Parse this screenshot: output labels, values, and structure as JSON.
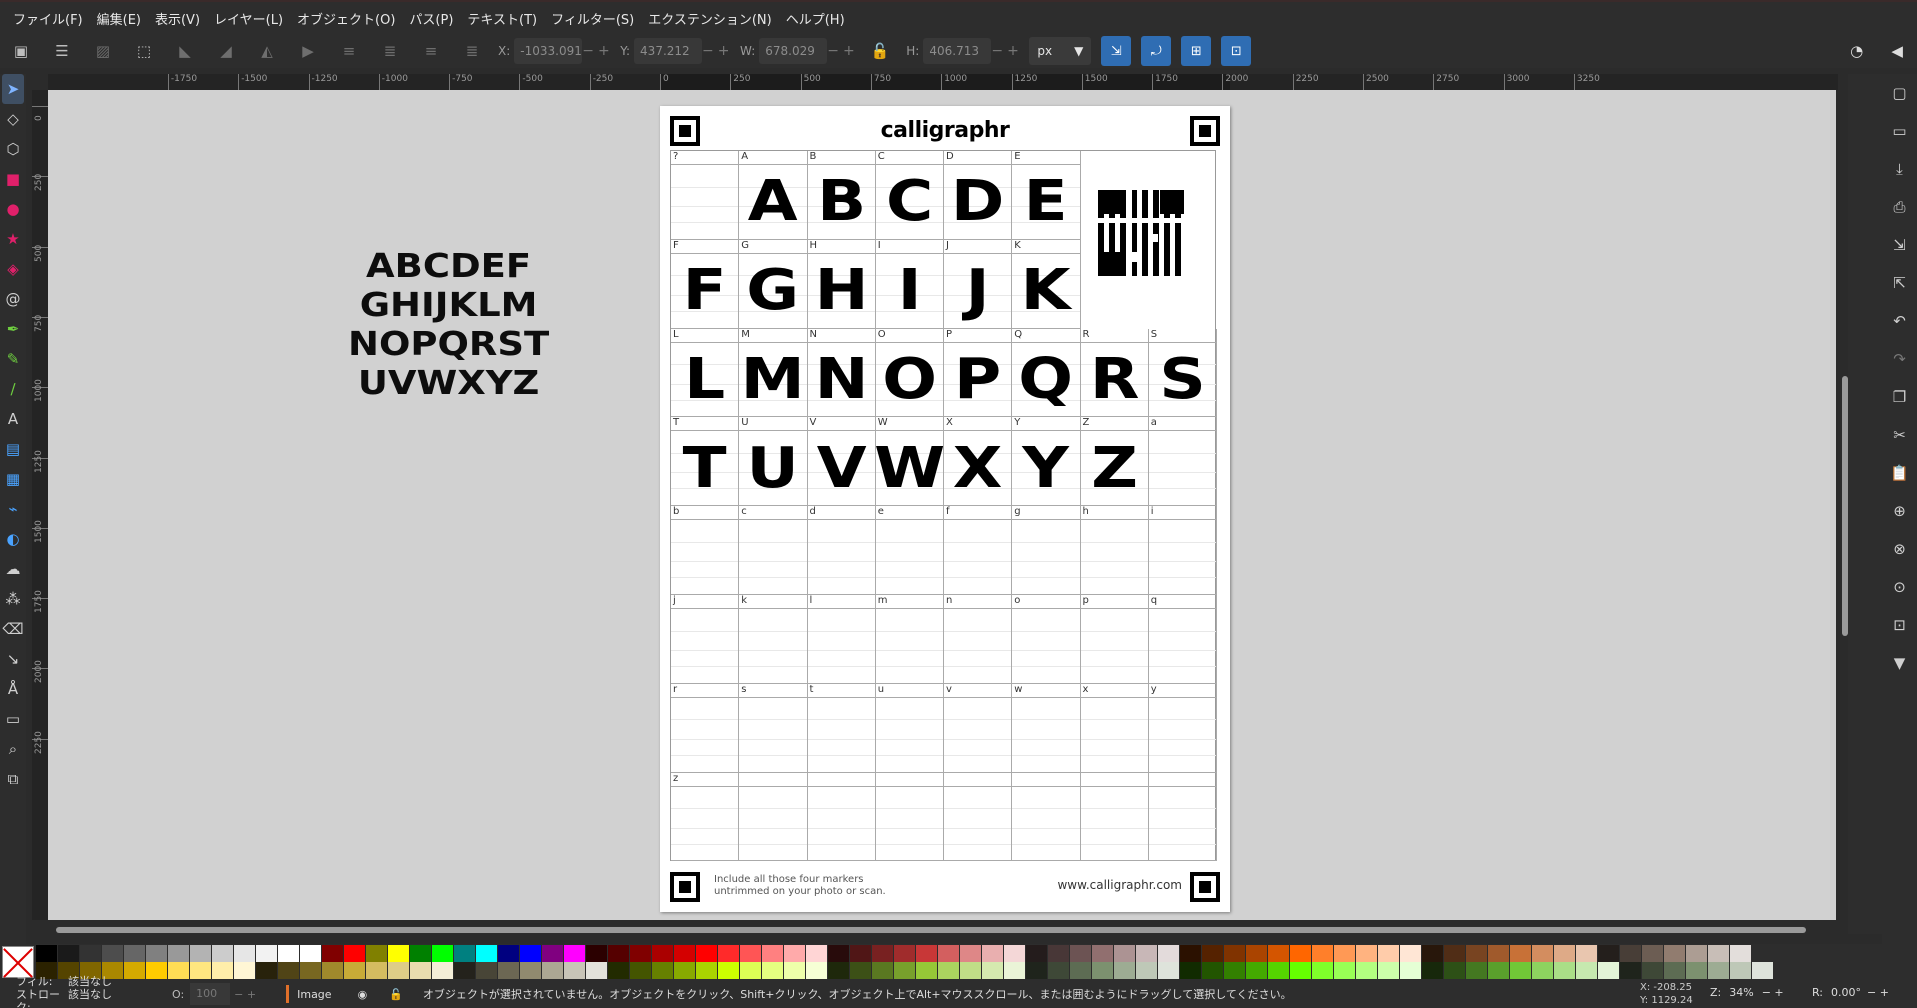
{
  "menu": [
    "ファイル(F)",
    "編集(E)",
    "表示(V)",
    "レイヤー(L)",
    "オブジェクト(O)",
    "パス(P)",
    "テキスト(T)",
    "フィルター(S)",
    "エクステンション(N)",
    "ヘルプ(H)"
  ],
  "toolbar": {
    "x_label": "X:",
    "x_value": "-1033.091",
    "y_label": "Y:",
    "y_value": "437.212",
    "w_label": "W:",
    "w_value": "678.029",
    "h_label": "H:",
    "h_value": "406.713",
    "unit": "px"
  },
  "ruler_h": [
    "-1750",
    "-1500",
    "-1250",
    "-1000",
    "-750",
    "-500",
    "-250",
    "0",
    "250",
    "500",
    "750",
    "1000",
    "1250",
    "1500",
    "1750",
    "2000",
    "2250",
    "2500",
    "2750",
    "3000",
    "3250"
  ],
  "ruler_v": [
    "0",
    "250",
    "500",
    "750",
    "1000",
    "1250",
    "1500",
    "1750",
    "2000",
    "2250"
  ],
  "sample_text": [
    "ABCDEF",
    "GHIJKLM",
    "NOPQRST",
    "UVWXYZ"
  ],
  "template": {
    "brand": "calligraphr",
    "footer_note_1": "Include all those four markers",
    "footer_note_2": "untrimmed on your photo or scan.",
    "footer_url": "www.calligraphr.com",
    "rows": [
      [
        "?",
        "A",
        "B",
        "C",
        "D",
        "E"
      ],
      [
        "F",
        "G",
        "H",
        "I",
        "J",
        "K"
      ],
      [
        "L",
        "M",
        "N",
        "O",
        "P",
        "Q",
        "R",
        "S"
      ],
      [
        "T",
        "U",
        "V",
        "W",
        "X",
        "Y",
        "Z",
        "a"
      ],
      [
        "b",
        "c",
        "d",
        "e",
        "f",
        "g",
        "h",
        "i"
      ],
      [
        "j",
        "k",
        "l",
        "m",
        "n",
        "o",
        "p",
        "q"
      ],
      [
        "r",
        "s",
        "t",
        "u",
        "v",
        "w",
        "x",
        "y"
      ],
      [
        "z",
        "",
        "",
        "",
        "",
        "",
        "",
        ""
      ]
    ],
    "glyphs": [
      [
        "",
        "A",
        "B",
        "C",
        "D",
        "E"
      ],
      [
        "F",
        "G",
        "H",
        "I",
        "J",
        "K"
      ],
      [
        "L",
        "M",
        "N",
        "O",
        "P",
        "Q",
        "R",
        "S"
      ],
      [
        "T",
        "U",
        "V",
        "W",
        "X",
        "Y",
        "Z",
        ""
      ]
    ]
  },
  "status": {
    "fill_label": "フィル:",
    "fill_value": "該当なし",
    "stroke_label": "ストローク:",
    "stroke_value": "該当なし",
    "opacity_label": "O:",
    "opacity_value": "100",
    "layer": "Image",
    "message": "オブジェクトが選択されていません。オブジェクトをクリック、Shift+クリック、オブジェクト上でAlt+マウススクロール、または囲むようにドラッグして選択してください。",
    "cursor_x_label": "X:",
    "cursor_x": "-208.25",
    "cursor_y_label": "Y:",
    "cursor_y": "1129.24",
    "zoom_label": "Z:",
    "zoom": "34%",
    "rotation_label": "R:",
    "rotation": "0.00°"
  },
  "palette": {
    "row1": [
      "#000000",
      "#1a1a1a",
      "#333333",
      "#4d4d4d",
      "#666666",
      "#808080",
      "#999999",
      "#b3b3b3",
      "#cccccc",
      "#e6e6e6",
      "#f2f2f2",
      "#ffffff",
      "#ffffff",
      "#800000",
      "#ff0000",
      "#808000",
      "#ffff00",
      "#008000",
      "#00ff00",
      "#008080",
      "#00ffff",
      "#000080",
      "#0000ff",
      "#800080",
      "#ff00ff",
      "#2b0000",
      "#550000",
      "#800000",
      "#aa0000",
      "#d40000",
      "#ff0000",
      "#ff2a2a",
      "#ff5555",
      "#ff8080",
      "#ffaaaa",
      "#ffd5d5",
      "#280b0b",
      "#501616",
      "#782121",
      "#a02c2c",
      "#c83737",
      "#d35f5f",
      "#de8787",
      "#e9afaf",
      "#f4d7d7",
      "#241c1c",
      "#483737",
      "#6c5353",
      "#916f6f",
      "#ac9393",
      "#c8b7b7",
      "#e3dbdb",
      "#2b1100",
      "#552200",
      "#803300",
      "#aa4400",
      "#d45500",
      "#ff6600",
      "#ff7f2a",
      "#ff9955",
      "#ffb380",
      "#ffccaa",
      "#ffe6d5",
      "#28170b",
      "#502d16",
      "#784421",
      "#a05a2c",
      "#c87137",
      "#d38d5f",
      "#deaa87",
      "#e9c6af",
      "#241f1c",
      "#483e37",
      "#6c5d53",
      "#917c6f",
      "#ac9d93",
      "#c8beb7",
      "#e3dedb"
    ],
    "row2": [
      "#2b2200",
      "#554400",
      "#806600",
      "#aa8800",
      "#d4aa00",
      "#ffcc00",
      "#ffdd55",
      "#ffe680",
      "#ffeeaa",
      "#fff6d5",
      "#28220b",
      "#504416",
      "#786721",
      "#a0892c",
      "#c8ab37",
      "#d4bc60",
      "#decd87",
      "#e9ddaf",
      "#f4eed7",
      "#24221c",
      "#484537",
      "#6c6753",
      "#918a6f",
      "#aca793",
      "#c8c4b7",
      "#e3e2db",
      "#222b00",
      "#445500",
      "#668000",
      "#88aa00",
      "#aad400",
      "#ccff00",
      "#ddff55",
      "#e5ff80",
      "#eeffaa",
      "#f6ffd5",
      "#1e280b",
      "#3c5016",
      "#5a7821",
      "#78a02c",
      "#96c837",
      "#abd35f",
      "#c0de87",
      "#d5e9af",
      "#eaf4d7",
      "#1f241c",
      "#3e4837",
      "#5d6c53",
      "#7c916f",
      "#9dac93",
      "#bec8b7",
      "#dee3db",
      "#112b00",
      "#225500",
      "#338000",
      "#44aa00",
      "#55d400",
      "#66ff00",
      "#7fff2a",
      "#99ff55",
      "#b3ff80",
      "#ccffaa",
      "#e5ffd5",
      "#17280b",
      "#2d5016",
      "#447821",
      "#5aa02c",
      "#71c837",
      "#8dd35f",
      "#aade87",
      "#c6e9af",
      "#e3f4d7",
      "#1f241c",
      "#3e4837",
      "#5d6c53",
      "#7c916f",
      "#9dac93",
      "#bec8b7",
      "#dee3db"
    ]
  }
}
